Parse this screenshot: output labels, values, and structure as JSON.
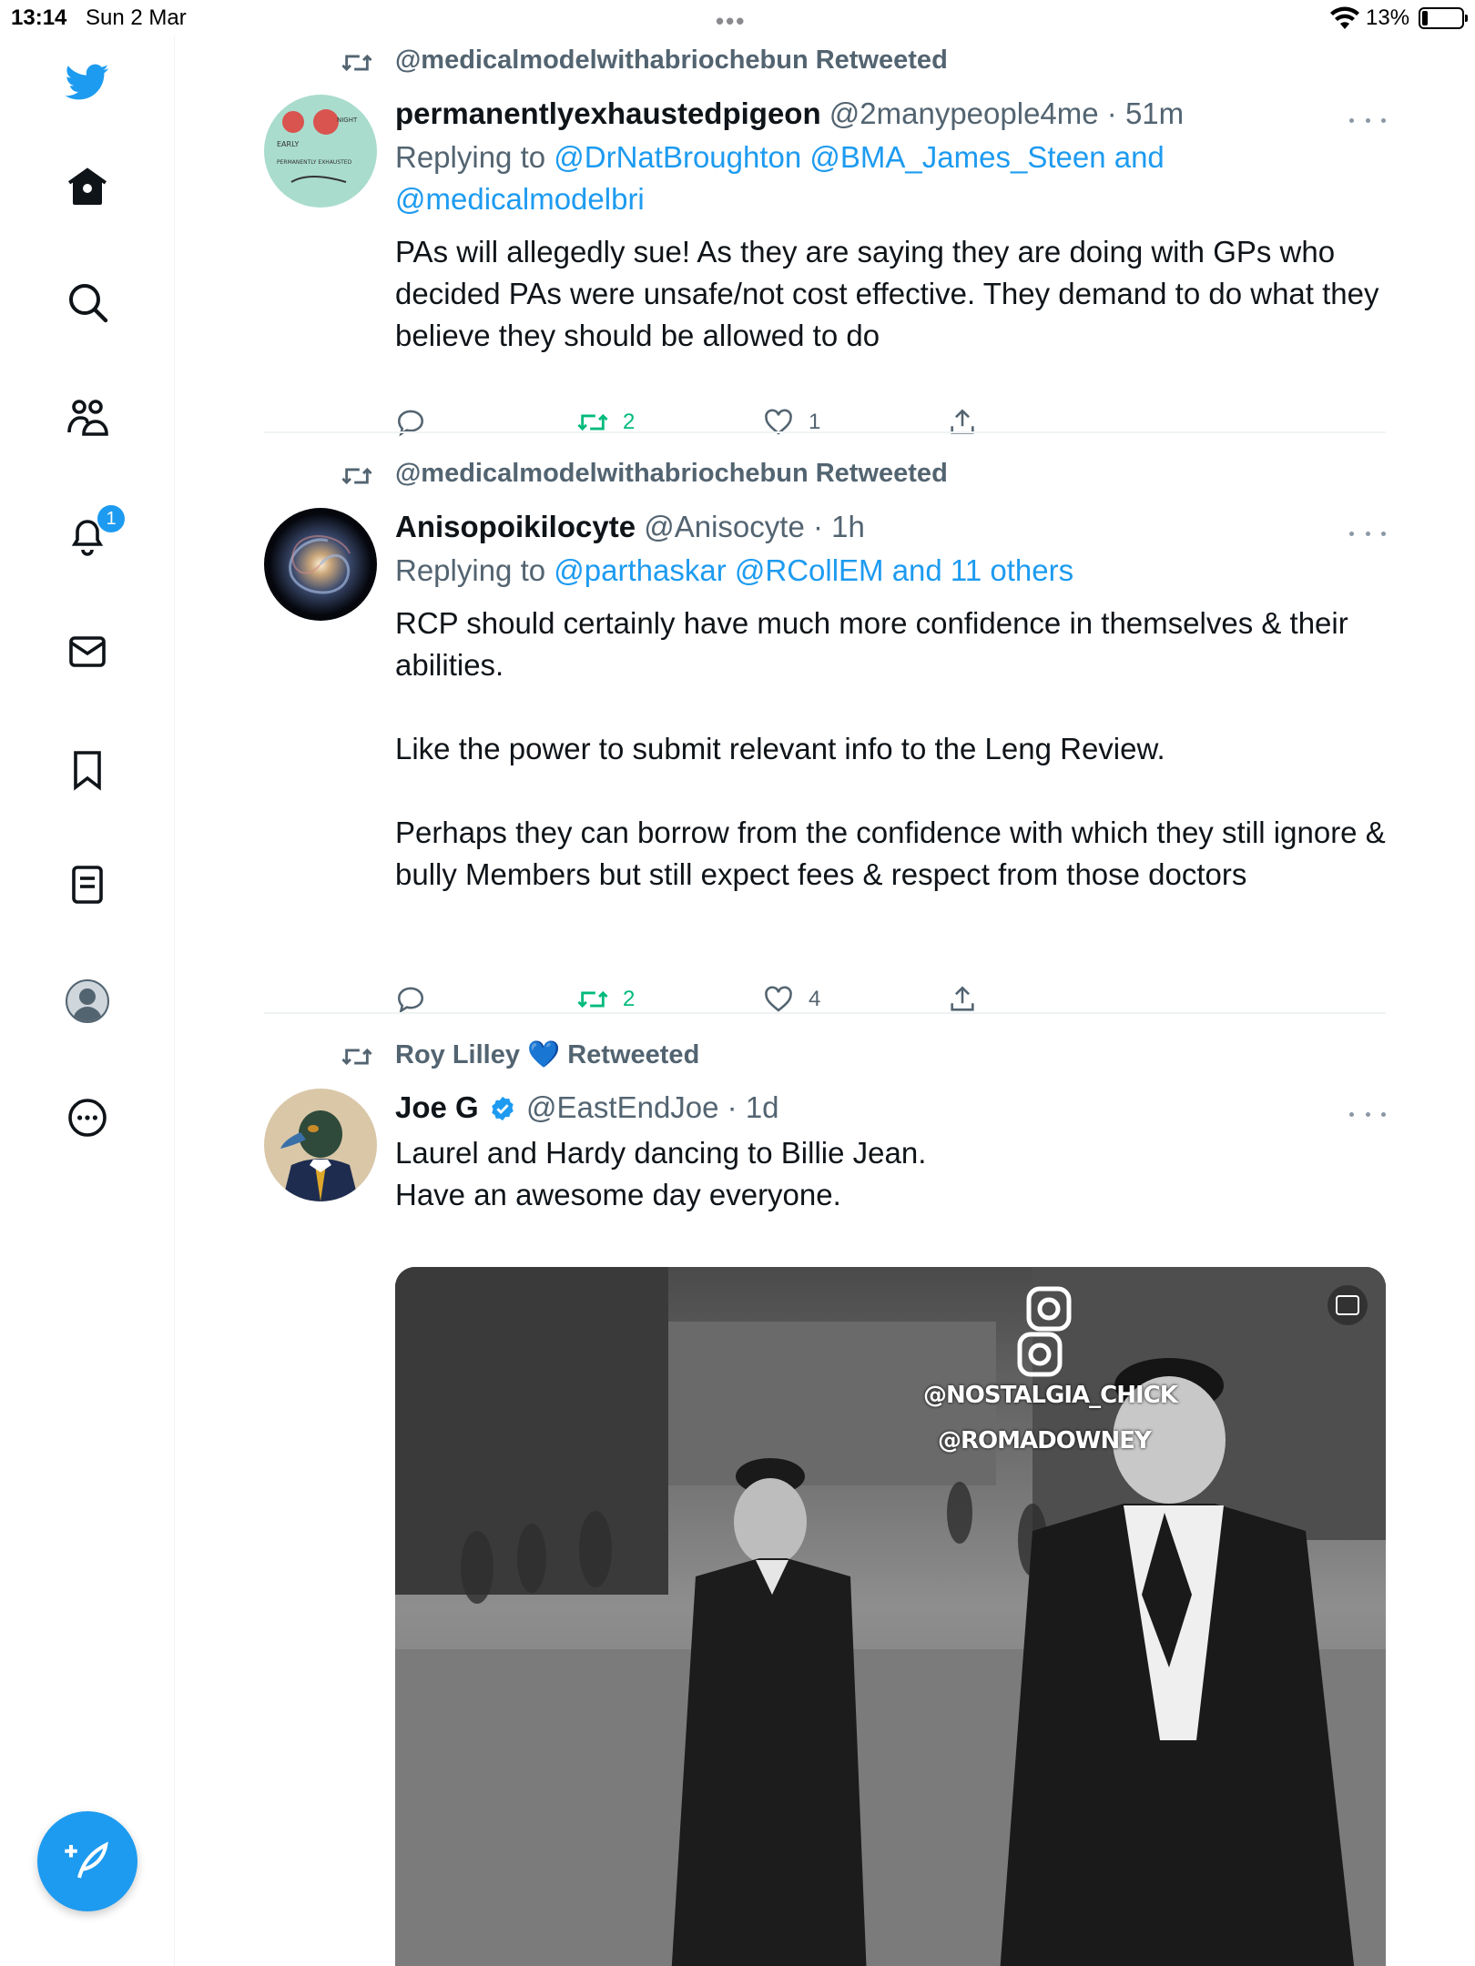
{
  "status_bar": {
    "time": "13:14",
    "date": "Sun 2 Mar",
    "battery": "13%"
  },
  "sidebar": {
    "items": [
      {
        "name": "twitter-logo",
        "icon": "bird-icon"
      },
      {
        "name": "home",
        "icon": "home-icon"
      },
      {
        "name": "explore",
        "icon": "search-icon"
      },
      {
        "name": "communities",
        "icon": "people-icon"
      },
      {
        "name": "notifications",
        "icon": "bell-icon",
        "badge": "1"
      },
      {
        "name": "messages",
        "icon": "mail-icon"
      },
      {
        "name": "bookmarks",
        "icon": "bookmark-icon"
      },
      {
        "name": "lists",
        "icon": "list-icon"
      },
      {
        "name": "profile",
        "icon": "avatar-icon"
      },
      {
        "name": "more",
        "icon": "more-circle-icon"
      }
    ],
    "notification_badge": "1",
    "compose_icon": "compose-icon"
  },
  "tweets": [
    {
      "retweeted_by": "@medicalmodelwithabriochebun Retweeted",
      "name": "permanentlyexhaustedpigeon",
      "handle_time": "@2manypeople4me · 51m",
      "replying_prefix": "Replying to",
      "replying_to": "@DrNatBroughton @BMA_James_Steen and",
      "replying_to_2": "@medicalmodelbri",
      "text": "PAs will allegedly sue! As they are saying they are doing with GPs who decided PAs were unsafe/not cost effective. They demand to do what they believe they should be allowed to do",
      "retweets": "2",
      "likes": "1"
    },
    {
      "retweeted_by": "@medicalmodelwithabriochebun Retweeted",
      "name": "Anisopoikilocyte",
      "handle_time": "@Anisocyte · 1h",
      "replying_prefix": "Replying to",
      "replying_to": "@parthaskar @RCollEM and 11 others",
      "text": "RCP should certainly have much more confidence in themselves & their abilities.\n\nLike the power to submit relevant info to the Leng Review.\n\nPerhaps they can borrow from the confidence with which they still ignore & bully Members but still expect fees & respect from those doctors",
      "retweets": "2",
      "likes": "4"
    },
    {
      "retweeted_by_name": "Roy Lilley",
      "retweeted_by_emoji": "💙",
      "retweeted_suffix": "Retweeted",
      "name": "Joe G",
      "handle_time": "@EastEndJoe · 1d",
      "text": "Laurel and Hardy dancing to Billie Jean.\nHave an awesome day everyone.",
      "media_watermark_1": "@NOSTALGIA_CHICK",
      "media_watermark_2": "@ROMADOWNEY"
    }
  ],
  "colors": {
    "accent": "#1d9bf0",
    "secondary_text": "#536471",
    "retweet_green": "#00ba7c"
  }
}
